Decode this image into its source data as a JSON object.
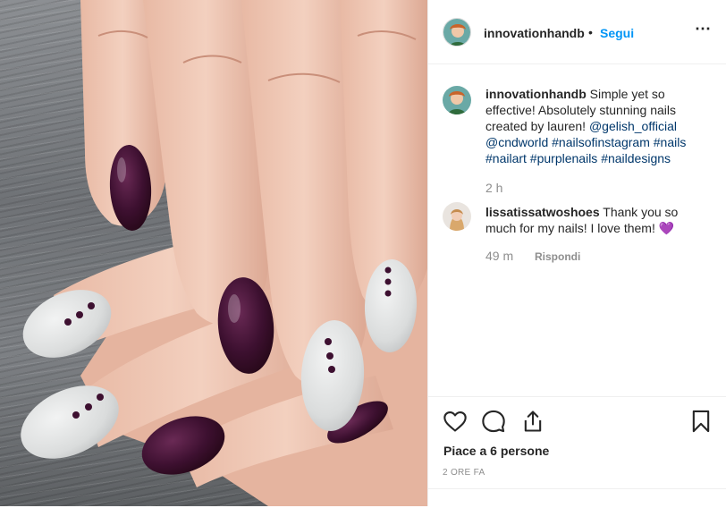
{
  "post": {
    "username": "innovationhandb",
    "separator": "•",
    "follow_label": "Segui",
    "more_icon": "⋯"
  },
  "caption": {
    "username": "innovationhandb",
    "text": "Simple yet so effective! Absolutely stunning nails created by lauren!",
    "mention_1": "@gelish_official",
    "mention_2": "@cndworld",
    "hashtags": "#nailsofinstagram #nails #nailart #purplenails #naildesigns",
    "time": "2 h"
  },
  "comment": {
    "username": "lissatissatwoshoes",
    "text": "Thank you so much for my nails! I love them!",
    "emoji": "💜",
    "time": "49 m",
    "reply_label": "Rispondi"
  },
  "actions": {
    "like_icon": "heart-icon",
    "comment_icon": "comment-icon",
    "share_icon": "share-icon",
    "save_icon": "bookmark-icon",
    "likes_text": "Piace a 6 persone",
    "post_time": "2 ORE FA"
  },
  "colors": {
    "link": "#0095f6",
    "hashtag": "#00376b",
    "secondary_text": "#8e8e8e",
    "nail_purple": "#3d1030",
    "nail_grey": "#dfe0e0"
  }
}
